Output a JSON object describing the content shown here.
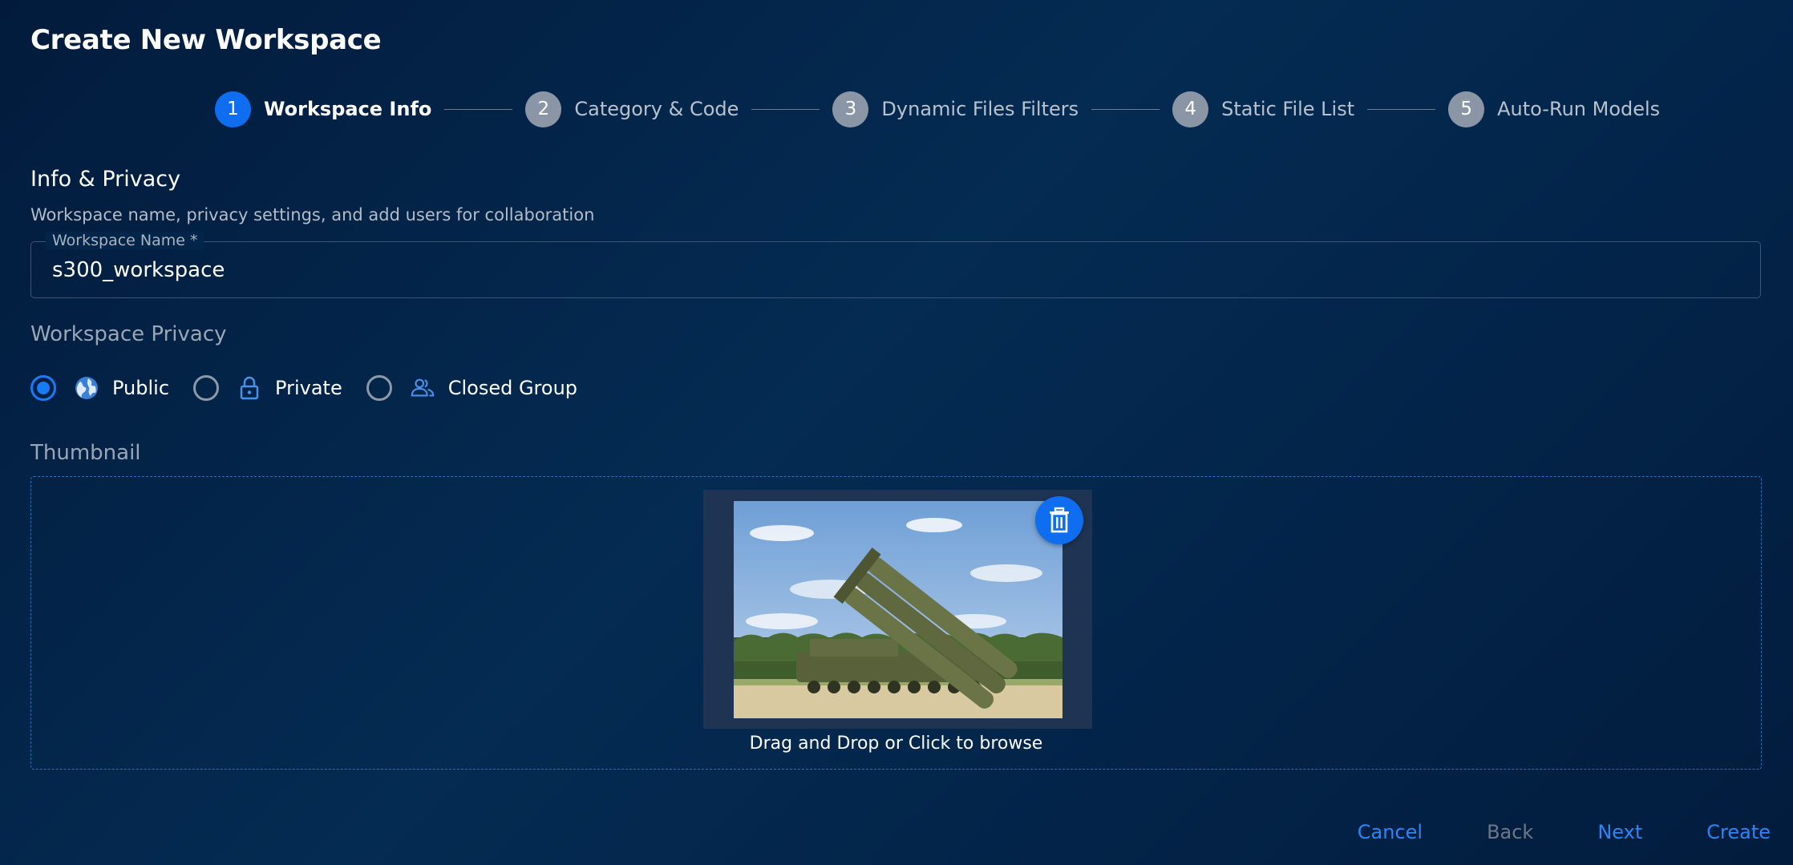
{
  "page": {
    "title": "Create New Workspace"
  },
  "stepper": {
    "steps": [
      {
        "number": "1",
        "label": "Workspace Info",
        "active": true
      },
      {
        "number": "2",
        "label": "Category & Code",
        "active": false
      },
      {
        "number": "3",
        "label": "Dynamic Files Filters",
        "active": false
      },
      {
        "number": "4",
        "label": "Static File List",
        "active": false
      },
      {
        "number": "5",
        "label": "Auto-Run Models",
        "active": false
      }
    ]
  },
  "info_section": {
    "title": "Info & Privacy",
    "subtitle": "Workspace name, privacy settings, and add users for collaboration"
  },
  "workspace_name": {
    "label": "Workspace Name *",
    "value": "s300_workspace"
  },
  "privacy": {
    "label": "Workspace Privacy",
    "selected": "Public",
    "options": [
      {
        "label": "Public",
        "icon": "globe-icon",
        "checked": true
      },
      {
        "label": "Private",
        "icon": "lock-icon",
        "checked": false
      },
      {
        "label": "Closed Group",
        "icon": "users-icon",
        "checked": false
      }
    ]
  },
  "thumbnail": {
    "label": "Thumbnail",
    "drop_text": "Drag and Drop or Click to browse",
    "delete_icon": "trash-icon"
  },
  "footer": {
    "cancel": "Cancel",
    "back": "Back",
    "next": "Next",
    "create": "Create"
  },
  "colors": {
    "accent": "#0f6ef0",
    "link": "#2b86f5",
    "inactive_step": "#8a96a6",
    "background": "#032449"
  }
}
